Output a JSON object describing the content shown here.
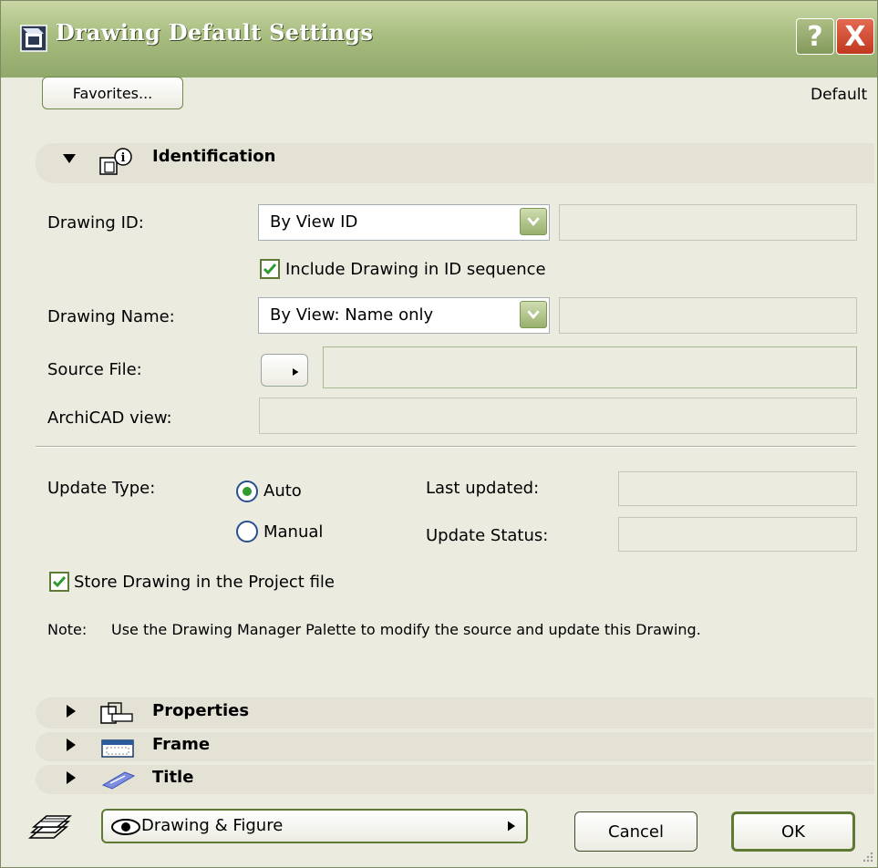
{
  "window": {
    "title": "Drawing Default Settings",
    "help_label": "?",
    "close_label": "X"
  },
  "toolbar": {
    "favorites_label": "Favorites...",
    "default_label": "Default"
  },
  "identification": {
    "title": "Identification",
    "drawing_id_label": "Drawing ID:",
    "drawing_id_value": "By View ID",
    "include_in_sequence_label": "Include Drawing in ID sequence",
    "include_in_sequence_checked": true,
    "drawing_name_label": "Drawing Name:",
    "drawing_name_value": "By View: Name only",
    "source_file_label": "Source File:",
    "archicad_view_label": "ArchiCAD view:",
    "update_type_label": "Update Type:",
    "update_auto_label": "Auto",
    "update_manual_label": "Manual",
    "update_type_selected": "Auto",
    "last_updated_label": "Last updated:",
    "update_status_label": "Update Status:",
    "store_in_project_label": "Store Drawing in the Project file",
    "store_in_project_checked": true,
    "note_prefix": "Note:",
    "note_text": "Use the Drawing Manager Palette to modify the source and update this Drawing."
  },
  "sections": {
    "properties": "Properties",
    "frame": "Frame",
    "title": "Title"
  },
  "footer": {
    "layer_value": "Drawing & Figure",
    "cancel_label": "Cancel",
    "ok_label": "OK"
  },
  "colors": {
    "titlebar": "#a8bd80",
    "dialog_bg": "#ecebe0",
    "accent_green": "#5f7a34",
    "close_red": "#c0391f"
  }
}
